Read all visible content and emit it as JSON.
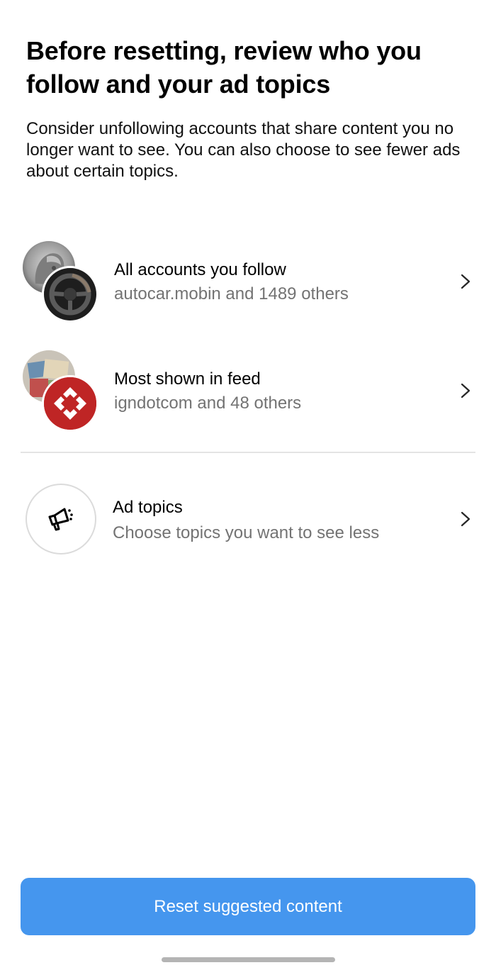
{
  "header": {
    "title": "Before resetting, review who you follow and your ad topics",
    "description": "Consider unfollowing accounts that share content you no longer want to see. You can also choose to see fewer ads about certain topics."
  },
  "rows": [
    {
      "title": "All accounts you follow",
      "subtitle": "autocar.mobin and 1489 others",
      "icon": "chevron-right-icon"
    },
    {
      "title": "Most shown in feed",
      "subtitle": "igndotcom and 48 others",
      "icon": "chevron-right-icon"
    },
    {
      "title": "Ad topics",
      "subtitle": "Choose topics you want to see less",
      "icon": "megaphone-icon"
    }
  ],
  "footer": {
    "button_label": "Reset suggested content",
    "button_color": "#4596ee"
  },
  "colors": {
    "secondary_text": "#737373",
    "divider": "#e4e4e4",
    "ign_red": "#bf2525"
  }
}
